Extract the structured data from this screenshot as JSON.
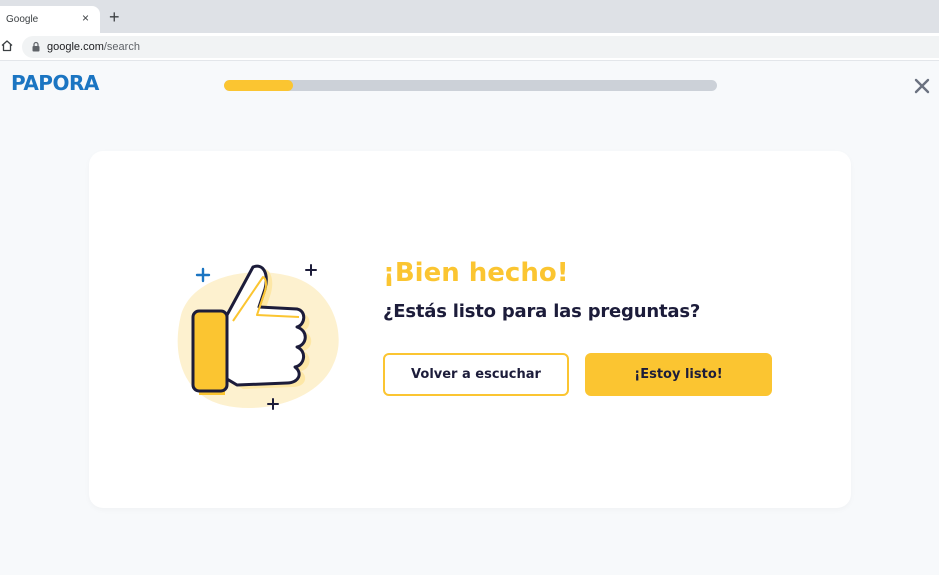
{
  "browser": {
    "tab_title": "Google",
    "tab_close": "×",
    "new_tab": "+",
    "url_host": "google.com",
    "url_path": "/search"
  },
  "app": {
    "logo": "PAPORA",
    "progress": 0.14,
    "close_icon": "close-icon"
  },
  "card": {
    "heading": "¡Bien hecho!",
    "subheading": "¿Estás listo para las preguntas?",
    "secondary_button": "Volver a escuchar",
    "primary_button": "¡Estoy listo!",
    "illustration_icon": "thumbs-up-icon"
  },
  "colors": {
    "accent": "#fbc531",
    "brand": "#1b75c2",
    "text_dark": "#1c1c3a",
    "track": "#ccd1d8"
  }
}
